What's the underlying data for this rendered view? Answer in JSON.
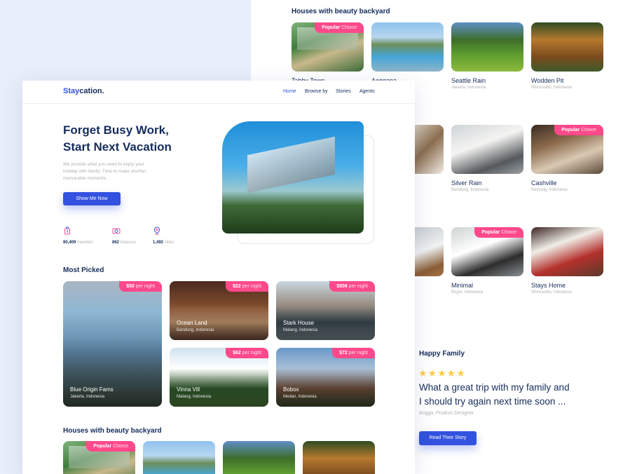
{
  "brand": {
    "prefix": "Stay",
    "suffix": "cation."
  },
  "nav": {
    "home": "Home",
    "browse": "Browse by",
    "stories": "Stories",
    "agents": "Agents"
  },
  "hero": {
    "title_line1": "Forget Busy Work,",
    "title_line2": "Start Next Vacation",
    "desc_line1": "We provide what you need to enjoy your",
    "desc_line2": "holiday with family. Time to make another",
    "desc_line3": "memorable moments.",
    "cta": "Show Me Now",
    "stats": [
      {
        "value": "80,409",
        "label": "travelers",
        "icon": "traveler-icon"
      },
      {
        "value": "862",
        "label": "treasure",
        "icon": "camera-icon"
      },
      {
        "value": "1,492",
        "label": "cities",
        "icon": "map-pin-icon"
      }
    ]
  },
  "most_picked": {
    "title": "Most Picked",
    "items": [
      {
        "name": "Blue Origin Fams",
        "location": "Jakarta, Indonesia",
        "price": "$50",
        "unit": "per night"
      },
      {
        "name": "Ocean Land",
        "location": "Bandung, Indonesia",
        "price": "$22",
        "unit": "per night"
      },
      {
        "name": "Stark House",
        "location": "Malang, Indonesia",
        "price": "$856",
        "unit": "per night"
      },
      {
        "name": "Vinna Vill",
        "location": "Malang, Indonesia",
        "price": "$62",
        "unit": "per night"
      },
      {
        "name": "Bobox",
        "location": "Medan, Indonesia",
        "price": "$72",
        "unit": "per night"
      }
    ]
  },
  "backyard_front": {
    "title": "Houses with beauty backyard",
    "badge_bold": "Popular",
    "badge_rest": "Choice"
  },
  "backyard_back": {
    "title": "Houses with beauty backyard",
    "badge_bold": "Popular",
    "badge_rest": "Choice",
    "row1": [
      {
        "name": "Tabby Town",
        "location": ""
      },
      {
        "name": "Anggana",
        "location": ""
      },
      {
        "name": "Seattle Rain",
        "location": "Jakarta, Indonesia"
      },
      {
        "name": "Wodden Pit",
        "location": "Wonosobo, Indonesia"
      }
    ],
    "row2": [
      {
        "name": "Silver Rain",
        "location": "Bandung, Indonesia"
      },
      {
        "name": "Cashville",
        "location": "Kemang, Indonesia"
      }
    ],
    "row3": [
      {
        "name": "Minimal",
        "location": "Bogor, Indonesia"
      },
      {
        "name": "Stays Home",
        "location": "Wonosobo, Indonesia"
      }
    ]
  },
  "testimonial": {
    "title": "Happy Family",
    "stars": 5,
    "star_glyphs": "★★★★★",
    "quote_line1": "What a great trip with my family and",
    "quote_line2": "I should try again next time soon ...",
    "author": "Angga, Product Designer",
    "cta": "Read Their Story"
  },
  "colors": {
    "primary": "#3252df",
    "dark": "#152c5b",
    "pink": "#ff498b",
    "star": "#ffcc47",
    "muted": "#b0b0b0"
  }
}
